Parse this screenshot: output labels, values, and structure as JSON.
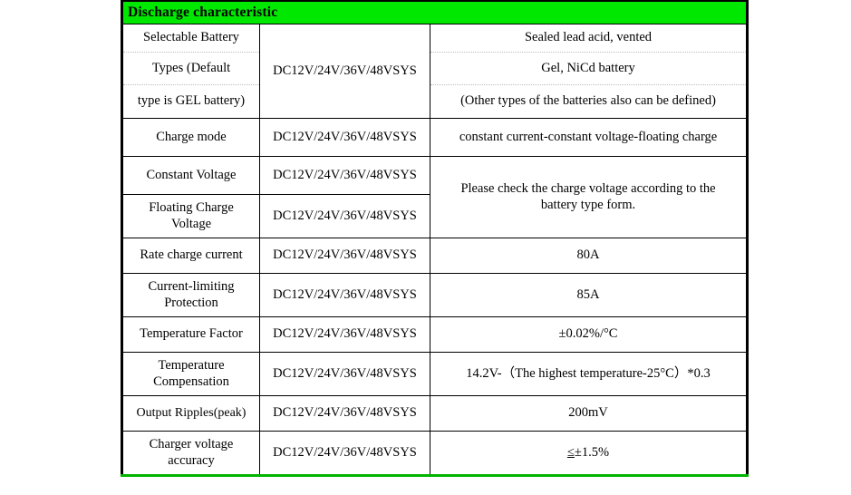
{
  "table": {
    "header": "Discharge characteristic",
    "header_bg": "#00e800",
    "bottom_rule_color": "#00b400",
    "sys_label": "DC12V/24V/36V/48VSYS",
    "rows": [
      {
        "label": "Selectable Battery",
        "middle": "DC12V/24V/36V/48VSYS",
        "value": "Sealed lead acid, vented"
      },
      {
        "label": "Types (Default",
        "middle": "",
        "value": "Gel, NiCd battery"
      },
      {
        "label": "type is GEL battery)",
        "middle": "",
        "value": "(Other types of the batteries also can be defined)"
      },
      {
        "label": "Charge mode",
        "middle": "DC12V/24V/36V/48VSYS",
        "value": "constant current-constant voltage-floating charge"
      },
      {
        "label": "Constant Voltage",
        "middle": "DC12V/24V/36V/48VSYS",
        "value": "Please check the charge voltage according to the battery type form."
      },
      {
        "label_line1": "Floating Charge",
        "label_line2": "Voltage",
        "middle": "DC12V/24V/36V/48VSYS",
        "value": ""
      },
      {
        "label": "Rate charge current",
        "middle": "DC12V/24V/36V/48VSYS",
        "value": "80A"
      },
      {
        "label_line1": "Current-limiting",
        "label_line2": "Protection",
        "middle": "DC12V/24V/36V/48VSYS",
        "value": "85A"
      },
      {
        "label": "Temperature Factor",
        "middle": "DC12V/24V/36V/48VSYS",
        "value": "±0.02%/°C"
      },
      {
        "label_line1": "Temperature",
        "label_line2": "Compensation",
        "middle": "DC12V/24V/36V/48VSYS",
        "value": "14.2V-（The highest temperature-25°C）*0.3"
      },
      {
        "label": "Output Ripples(peak)",
        "middle": "DC12V/24V/36V/48VSYS",
        "value": "200mV"
      },
      {
        "label_line1": "Charger voltage",
        "label_line2": "accuracy",
        "middle": "DC12V/24V/36V/48VSYS",
        "value_prefix": "≤",
        "value_suffix": "±1.5%"
      }
    ]
  }
}
